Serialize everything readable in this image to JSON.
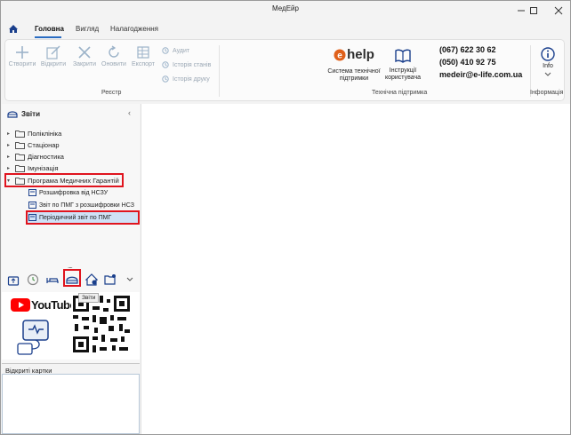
{
  "window": {
    "title": "МедЕйр"
  },
  "tabs": [
    {
      "label": "Головна"
    },
    {
      "label": "Вигляд"
    },
    {
      "label": "Налагодження"
    }
  ],
  "ribbon": {
    "registry": {
      "buttons": [
        {
          "label": "Створити",
          "icon": "plus-icon"
        },
        {
          "label": "Відкрити",
          "icon": "edit-icon"
        },
        {
          "label": "Закрити",
          "icon": "close-icon"
        },
        {
          "label": "Оновити",
          "icon": "refresh-icon"
        },
        {
          "label": "Експорт",
          "icon": "export-icon"
        }
      ],
      "small": [
        {
          "label": "Аудит",
          "icon": "clock-icon"
        },
        {
          "label": "Історія станів",
          "icon": "clock-icon"
        },
        {
          "label": "Історія друку",
          "icon": "clock-icon"
        }
      ],
      "group_label": "Реєстр"
    },
    "support": {
      "ehelp_logo": "help",
      "system_help": "Система технічної підтримки",
      "user_manual": "Інструкції користувача",
      "phones": [
        "(067) 622 30 62",
        "(050) 410 92 75"
      ],
      "email": "medeir@e-life.com.ua",
      "group_label": "Технічна підтримка"
    },
    "info": {
      "label": "Info",
      "group_label": "Інформація"
    }
  },
  "left_panel": {
    "title": "Звіти",
    "tree": [
      {
        "label": "Поліклініка",
        "expanded": false
      },
      {
        "label": "Стаціонар",
        "expanded": false
      },
      {
        "label": "Діагностика",
        "expanded": false
      },
      {
        "label": "Імунізація",
        "expanded": false
      },
      {
        "label": "Програма Медичних Гарантій",
        "expanded": true
      }
    ],
    "children": [
      {
        "label": "Розшифровка від НСЗУ"
      },
      {
        "label": "Звіт по ПМГ з розшифровки НСЗ"
      },
      {
        "label": "Періодичний звіт по ПМГ",
        "selected": true
      }
    ],
    "splitter": "....",
    "nav_tooltip": "Звіти",
    "youtube_label": "YouTube",
    "open_cards": "Відкриті картки"
  },
  "colors": {
    "accent": "#2a6cc2",
    "highlight_red": "#e0141e",
    "selection": "#cfe1f6",
    "youtube_red": "#ff0000"
  }
}
